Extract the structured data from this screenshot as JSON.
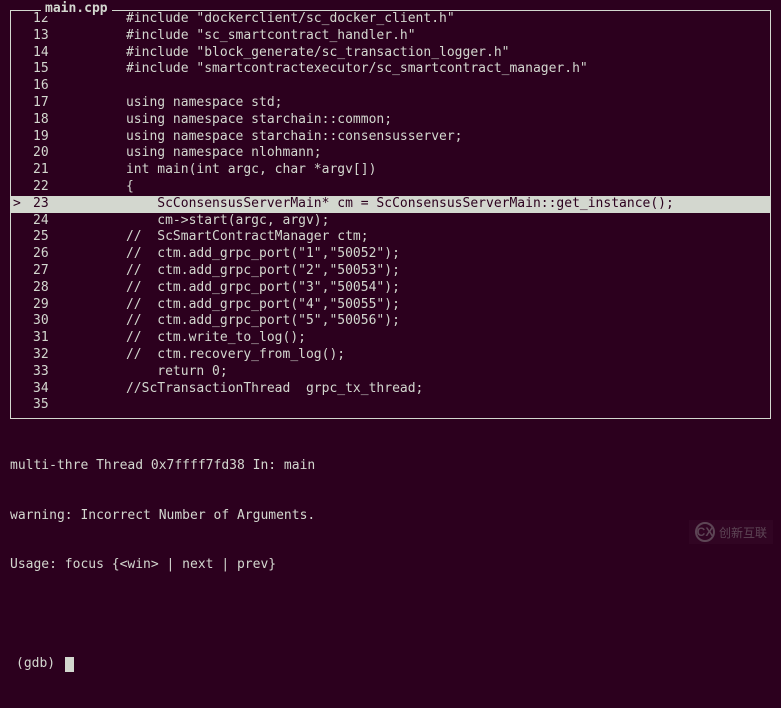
{
  "file_label": "main.cpp",
  "current_line": 23,
  "lines": [
    {
      "n": 12,
      "t": "      #include \"dockerclient/sc_docker_client.h\""
    },
    {
      "n": 13,
      "t": "      #include \"sc_smartcontract_handler.h\""
    },
    {
      "n": 14,
      "t": "      #include \"block_generate/sc_transaction_logger.h\""
    },
    {
      "n": 15,
      "t": "      #include \"smartcontractexecutor/sc_smartcontract_manager.h\""
    },
    {
      "n": 16,
      "t": ""
    },
    {
      "n": 17,
      "t": "      using namespace std;"
    },
    {
      "n": 18,
      "t": "      using namespace starchain::common;"
    },
    {
      "n": 19,
      "t": "      using namespace starchain::consensusserver;"
    },
    {
      "n": 20,
      "t": "      using namespace nlohmann;"
    },
    {
      "n": 21,
      "t": "      int main(int argc, char *argv[])"
    },
    {
      "n": 22,
      "t": "      {"
    },
    {
      "n": 23,
      "t": "          ScConsensusServerMain* cm = ScConsensusServerMain::get_instance();"
    },
    {
      "n": 24,
      "t": "          cm->start(argc, argv);"
    },
    {
      "n": 25,
      "t": "      //  ScSmartContractManager ctm;"
    },
    {
      "n": 26,
      "t": "      //  ctm.add_grpc_port(\"1\",\"50052\");"
    },
    {
      "n": 27,
      "t": "      //  ctm.add_grpc_port(\"2\",\"50053\");"
    },
    {
      "n": 28,
      "t": "      //  ctm.add_grpc_port(\"3\",\"50054\");"
    },
    {
      "n": 29,
      "t": "      //  ctm.add_grpc_port(\"4\",\"50055\");"
    },
    {
      "n": 30,
      "t": "      //  ctm.add_grpc_port(\"5\",\"50056\");"
    },
    {
      "n": 31,
      "t": "      //  ctm.write_to_log();"
    },
    {
      "n": 32,
      "t": "      //  ctm.recovery_from_log();"
    },
    {
      "n": 33,
      "t": "          return 0;"
    },
    {
      "n": 34,
      "t": "      //ScTransactionThread  grpc_tx_thread;"
    },
    {
      "n": 35,
      "t": ""
    }
  ],
  "output": {
    "thread_line": "multi-thre Thread 0x7ffff7fd38 In: main",
    "warning_line": "warning: Incorrect Number of Arguments.",
    "usage_line": "Usage: focus {<win> | next | prev}",
    "prompt": "(gdb) "
  },
  "watermark": {
    "icon_text": "CX",
    "label": "创新互联"
  }
}
